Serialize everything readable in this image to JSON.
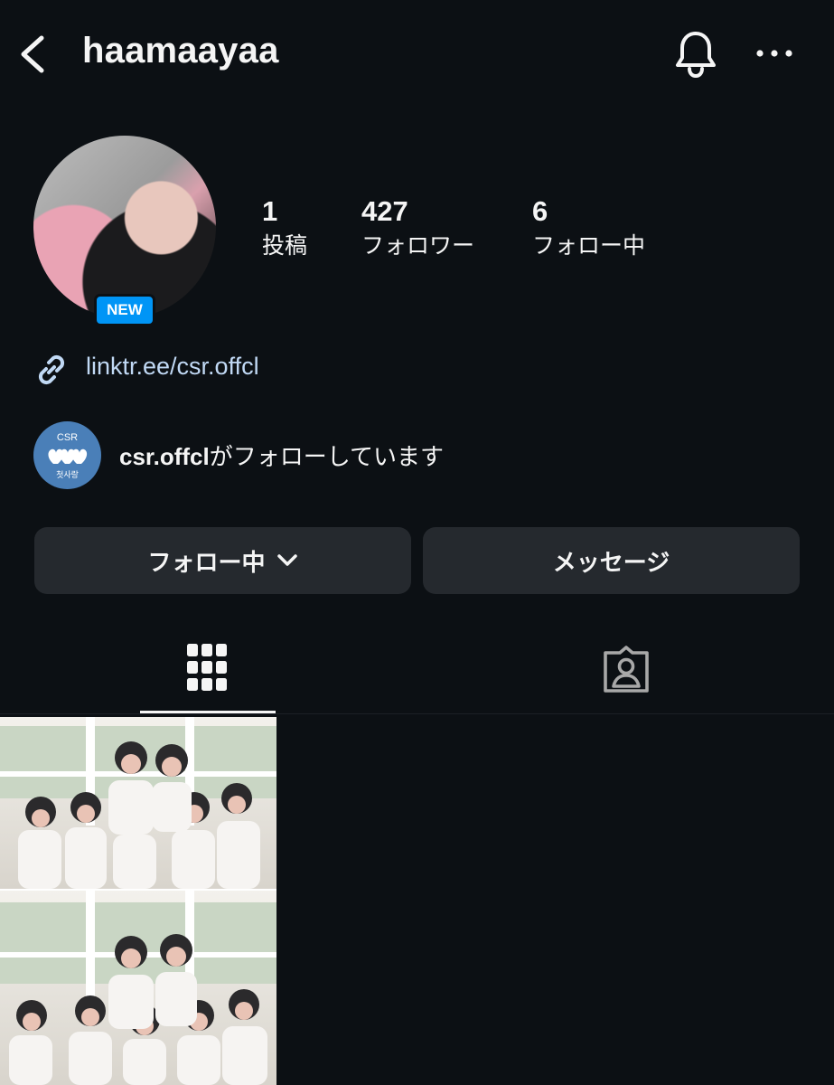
{
  "header": {
    "username": "haamaayaa",
    "back_icon": "chevron-left-icon",
    "bell_icon": "bell-icon",
    "more_icon": "more-horizontal-icon"
  },
  "profile": {
    "avatar_badge": "NEW",
    "stats": [
      {
        "value": "1",
        "label": "投稿"
      },
      {
        "value": "427",
        "label": "フォロワー"
      },
      {
        "value": "6",
        "label": "フォロー中"
      }
    ],
    "link": "linktr.ee/csr.offcl",
    "followed_by": {
      "avatar_line1": "CSR",
      "avatar_line2": "첫사랑",
      "account": "csr.offcl",
      "suffix": "がフォローしています"
    }
  },
  "actions": {
    "follow_label": "フォロー中",
    "message_label": "メッセージ"
  },
  "tabs": {
    "grid_icon": "grid-icon",
    "tagged_icon": "tagged-person-icon"
  },
  "colors": {
    "background": "#0c1014",
    "button": "#25292e",
    "accent": "#0095f6",
    "link": "#c1d9f5"
  }
}
